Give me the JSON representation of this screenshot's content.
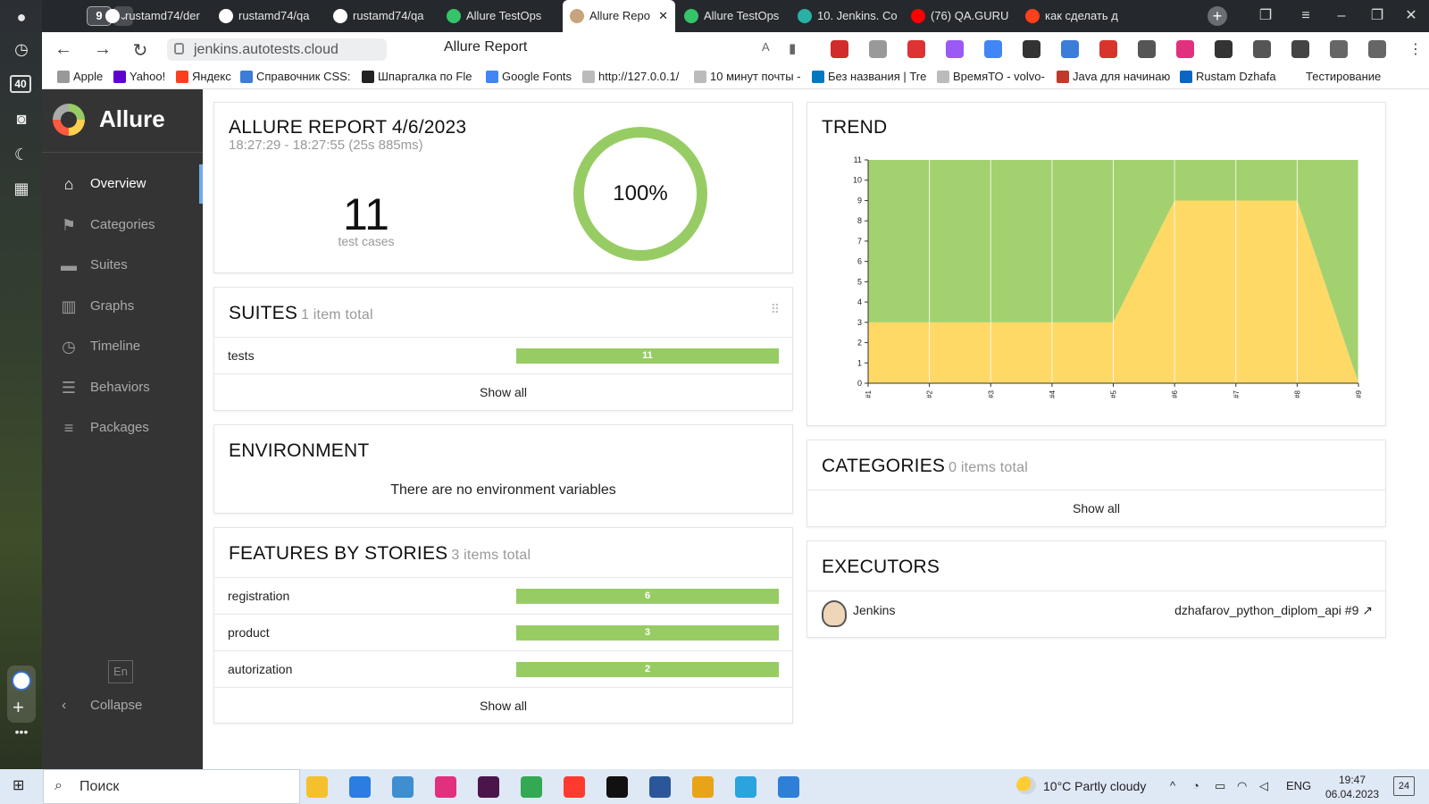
{
  "browser": {
    "tab_count": "9",
    "tabs": [
      {
        "label": "rustamd74/der",
        "color": "#ffffff"
      },
      {
        "label": "rustamd74/qa",
        "color": "#ffffff"
      },
      {
        "label": "rustamd74/qa",
        "color": "#ffffff"
      },
      {
        "label": "Allure TestOps",
        "color": "#35c46a"
      },
      {
        "label": "Allure Repo",
        "color": "#c8a37c"
      },
      {
        "label": "Allure TestOps",
        "color": "#35c46a"
      },
      {
        "label": "10. Jenkins. Co",
        "color": "#2bb0a5"
      },
      {
        "label": "(76) QA.GURU",
        "color": "#ff0000"
      },
      {
        "label": "как сделать д",
        "color": "#fc3f1d"
      }
    ],
    "url": "jenkins.autotests.cloud",
    "page_title": "Allure Report",
    "bookmarks": [
      {
        "label": "Apple",
        "color": "#999999"
      },
      {
        "label": "Yahoo!",
        "color": "#6001d2"
      },
      {
        "label": "Яндекс",
        "color": "#fc3f1d"
      },
      {
        "label": "Справочник CSS:",
        "color": "#3b7dd8"
      },
      {
        "label": "Шпаргалка по Fle",
        "color": "#222222"
      },
      {
        "label": "Google Fonts",
        "color": "#4285f4"
      },
      {
        "label": "http://127.0.0.1/",
        "color": "#bbbbbb"
      },
      {
        "label": "10 минут почты -",
        "color": "#bbbbbb"
      },
      {
        "label": "Без названия | Tre",
        "color": "#0079bf"
      },
      {
        "label": "ВремяТО - volvo-",
        "color": "#bbbbbb"
      },
      {
        "label": "Java для начинаю",
        "color": "#c0392b"
      },
      {
        "label": "Rustam Dzhafa",
        "color": "#0a66c2"
      },
      {
        "label": "Тестирование",
        "color": "#ffffff"
      }
    ],
    "rail_badge": "40"
  },
  "allure": {
    "brand": "Allure",
    "nav": [
      {
        "label": "Overview",
        "icon": "home-icon",
        "glyph": "⌂"
      },
      {
        "label": "Categories",
        "icon": "flag-icon",
        "glyph": "⚑"
      },
      {
        "label": "Suites",
        "icon": "briefcase-icon",
        "glyph": "▬"
      },
      {
        "label": "Graphs",
        "icon": "bar-chart-icon",
        "glyph": "▥"
      },
      {
        "label": "Timeline",
        "icon": "clock-icon",
        "glyph": "◷"
      },
      {
        "label": "Behaviors",
        "icon": "list-icon",
        "glyph": "☰"
      },
      {
        "label": "Packages",
        "icon": "align-left-icon",
        "glyph": "≡"
      }
    ],
    "lang": "En",
    "collapse": "Collapse"
  },
  "report": {
    "title": "ALLURE REPORT 4/6/2023",
    "time": "18:27:29 - 18:27:55 (25s 885ms)",
    "test_count": "11",
    "test_caption": "test cases",
    "percent": "100%",
    "success_fraction": 1.0
  },
  "suites": {
    "title": "SUITES",
    "total": "1 item total",
    "rows": [
      {
        "label": "tests",
        "value": "11"
      }
    ],
    "show_all": "Show all"
  },
  "environment": {
    "title": "ENVIRONMENT",
    "message": "There are no environment variables"
  },
  "features": {
    "title": "FEATURES BY STORIES",
    "total": "3 items total",
    "rows": [
      {
        "label": "registration",
        "value": "6"
      },
      {
        "label": "product",
        "value": "3"
      },
      {
        "label": "autorization",
        "value": "2"
      }
    ],
    "show_all": "Show all"
  },
  "trend": {
    "title": "TREND"
  },
  "chart_data": {
    "type": "area",
    "x": [
      "#1",
      "#2",
      "#3",
      "#4",
      "#5",
      "#6",
      "#7",
      "#8",
      "#9"
    ],
    "series": [
      {
        "values": [
          3,
          3,
          3,
          3,
          3,
          9,
          9,
          9,
          0
        ],
        "color": "#ffd966"
      },
      {
        "values": [
          8,
          8,
          8,
          8,
          8,
          2,
          2,
          2,
          11
        ],
        "color": "#a3d16f"
      }
    ],
    "ylim": [
      0,
      11
    ],
    "yticks": [
      "0",
      "1",
      "2",
      "3",
      "4",
      "5",
      "6",
      "7",
      "8",
      "9",
      "10",
      "11"
    ],
    "stacked": true,
    "grid": true
  },
  "categories": {
    "title": "CATEGORIES",
    "total": "0 items total",
    "show_all": "Show all"
  },
  "executors": {
    "title": "EXECUTORS",
    "name": "Jenkins",
    "build": "dzhafarov_python_diplom_api #9 ↗"
  },
  "taskbar": {
    "search": "Поиск",
    "weather": "10°C  Partly cloudy",
    "lang": "ENG",
    "time": "19:47",
    "date": "06.04.2023",
    "notifications": "24",
    "apps": [
      {
        "name": "file-explorer-icon",
        "color": "#f4c02e"
      },
      {
        "name": "mail-icon",
        "color": "#2a7de1"
      },
      {
        "name": "photos-icon",
        "color": "#3e8ed0"
      },
      {
        "name": "jetbrains-toolbox-icon",
        "color": "#e0307e"
      },
      {
        "name": "slack-icon",
        "color": "#4a154b"
      },
      {
        "name": "chrome-icon",
        "color": "#34a853"
      },
      {
        "name": "yandex-browser-icon",
        "color": "#ff3b30"
      },
      {
        "name": "pycharm-icon",
        "color": "#111111"
      },
      {
        "name": "word-icon",
        "color": "#2b579a"
      },
      {
        "name": "chrome-canary-icon",
        "color": "#e8a317"
      },
      {
        "name": "telegram-icon",
        "color": "#2aa3df"
      },
      {
        "name": "azure-data-studio-icon",
        "color": "#2d7fd8"
      }
    ]
  }
}
